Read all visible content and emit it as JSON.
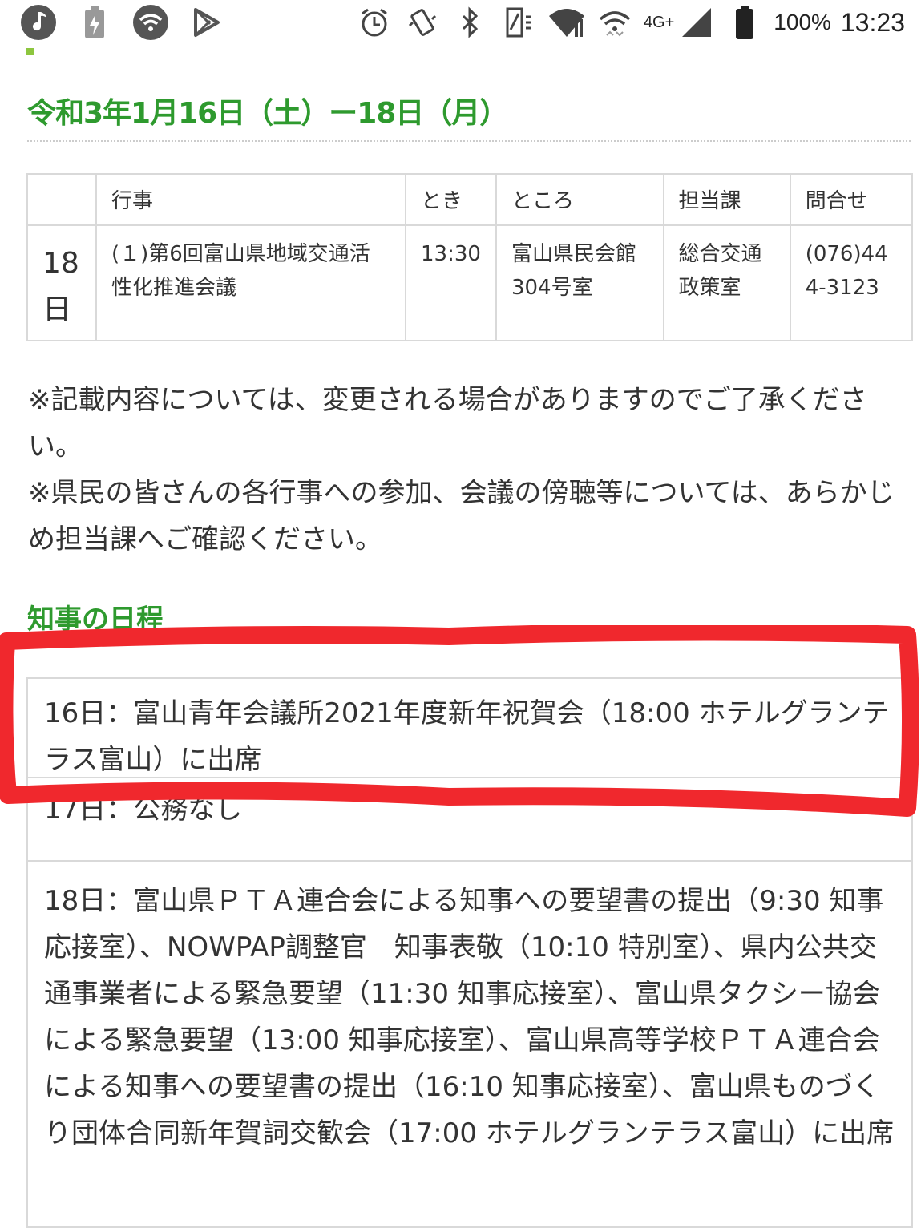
{
  "status_bar": {
    "battery": "100%",
    "time": "13:23",
    "network": "4G+",
    "left_icons": [
      "music-icon",
      "battery-saver-icon",
      "wifi-circle-icon",
      "play-store-icon"
    ],
    "right_icons": [
      "alarm-icon",
      "vibrate-icon",
      "bluetooth-icon",
      "nfc-icon",
      "wifi-icon",
      "wifi-calling-icon",
      "signal-icon",
      "battery-icon"
    ]
  },
  "heading_date": "令和3年1月16日（土）ー18日（月）",
  "events_table": {
    "headers": [
      "",
      "行事",
      "とき",
      "ところ",
      "担当課",
      "問合せ"
    ],
    "rows": [
      {
        "day": "18日",
        "event": "(１)第6回富山県地域交通活性化推進会議",
        "time": "13:30",
        "place": "富山県民会館304号室",
        "department": "総合交通政策室",
        "contact": "(076)444-3123"
      }
    ]
  },
  "notes": [
    "※記載内容については、変更される場合がありますのでご了承ください。",
    "※県民の皆さんの各行事への参加、会議の傍聴等については、あらかじめ担当課へご確認ください。"
  ],
  "heading_governor": "知事の日程",
  "schedule": [
    "16日：富山青年会議所2021年度新年祝賀会（18:00 ホテルグランテラス富山）に出席",
    "17日：公務なし",
    "18日：富山県ＰＴＡ連合会による知事への要望書の提出（9:30 知事応接室）、NOWPAP調整官　知事表敬（10:10 特別室）、県内公共交通事業者による緊急要望（11:30 知事応接室）、富山県タクシー協会による緊急要望（13:00 知事応接室）、富山県高等学校ＰＴＡ連合会による知事への要望書の提出（16:10 知事応接室）、富山県ものづくり団体合同新年賀詞交歓会（17:00 ホテルグランテラス富山）に出席"
  ],
  "colors": {
    "heading_green": "#2e9a2e",
    "annotation_red": "#f0282d"
  }
}
